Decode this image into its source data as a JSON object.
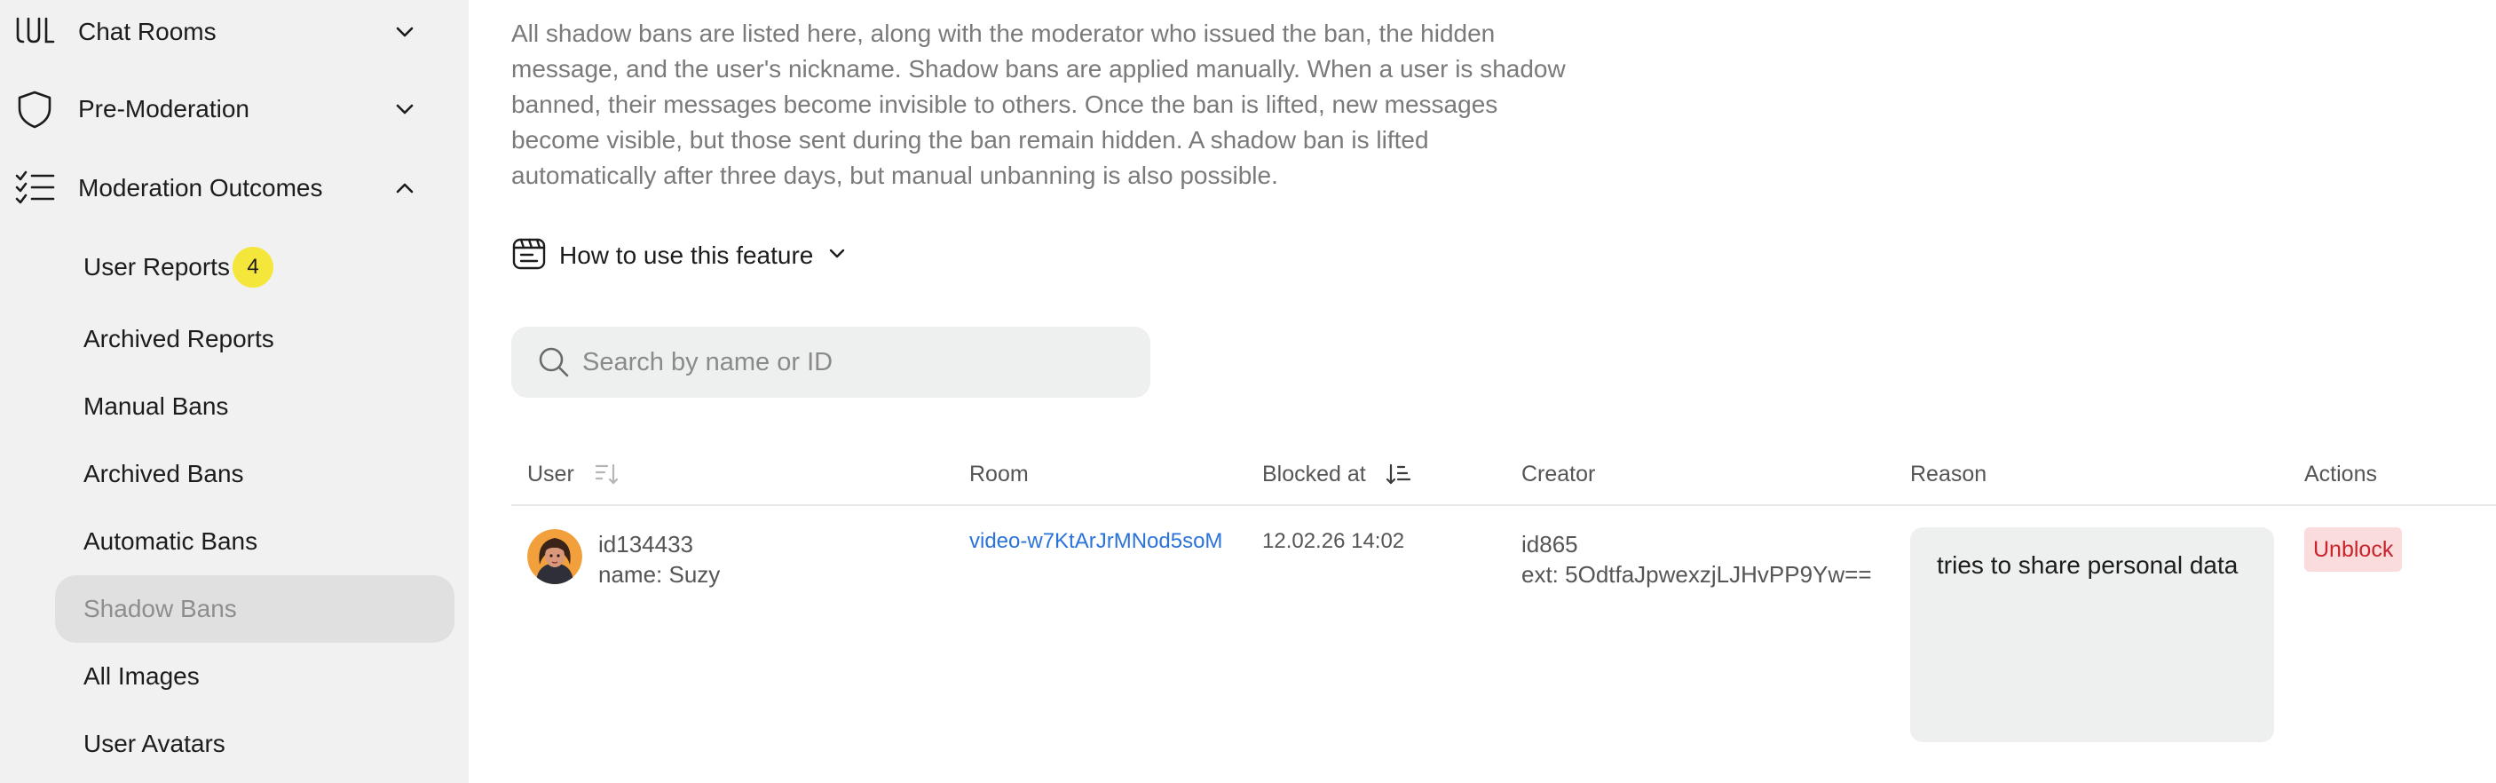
{
  "sidebar": {
    "groups": [
      {
        "label": "Chat Rooms",
        "icon": "chat-rooms-icon",
        "expanded": false
      },
      {
        "label": "Pre-Moderation",
        "icon": "shield-icon",
        "expanded": false
      },
      {
        "label": "Moderation Outcomes",
        "icon": "checklist-icon",
        "expanded": true
      }
    ],
    "items": [
      {
        "label": "User Reports",
        "badge": "4"
      },
      {
        "label": "Archived Reports"
      },
      {
        "label": "Manual Bans"
      },
      {
        "label": "Archived Bans"
      },
      {
        "label": "Automatic Bans"
      },
      {
        "label": "Shadow Bans",
        "active": true
      },
      {
        "label": "All Images"
      },
      {
        "label": "User Avatars"
      }
    ]
  },
  "main": {
    "description": "All shadow bans are listed here, along with the moderator who issued the ban, the hidden message, and the user's nickname. Shadow bans are applied manually. When a user is shadow banned, their messages become invisible to others. Once the ban is lifted, new messages become visible, but those sent during the ban remain hidden. A shadow ban is lifted automatically after three days, but manual unbanning is also possible.",
    "howto_label": "How to use this feature",
    "search": {
      "placeholder": "Search by name or ID",
      "value": ""
    },
    "table": {
      "columns": {
        "user": "User",
        "room": "Room",
        "blocked_at": "Blocked at",
        "creator": "Creator",
        "reason": "Reason",
        "actions": "Actions"
      },
      "rows": [
        {
          "user_id": "id134433",
          "user_name": "name: Suzy",
          "room": "video-w7KtArJrMNod5soM",
          "blocked_at": "12.02.26 14:02",
          "creator_id": "id865",
          "creator_ext": "ext: 5OdtfaJpwexzjLJHvPP9Yw==",
          "reason": "tries to share personal data",
          "action_label": "Unblock"
        }
      ]
    }
  },
  "colors": {
    "sidebar_bg": "#f1f1f1",
    "active_item_bg": "#e0e0e0",
    "badge_bg": "#f5e63c",
    "link": "#2a73d9",
    "unblock_bg": "#fadcdc",
    "unblock_text": "#c8242c"
  }
}
